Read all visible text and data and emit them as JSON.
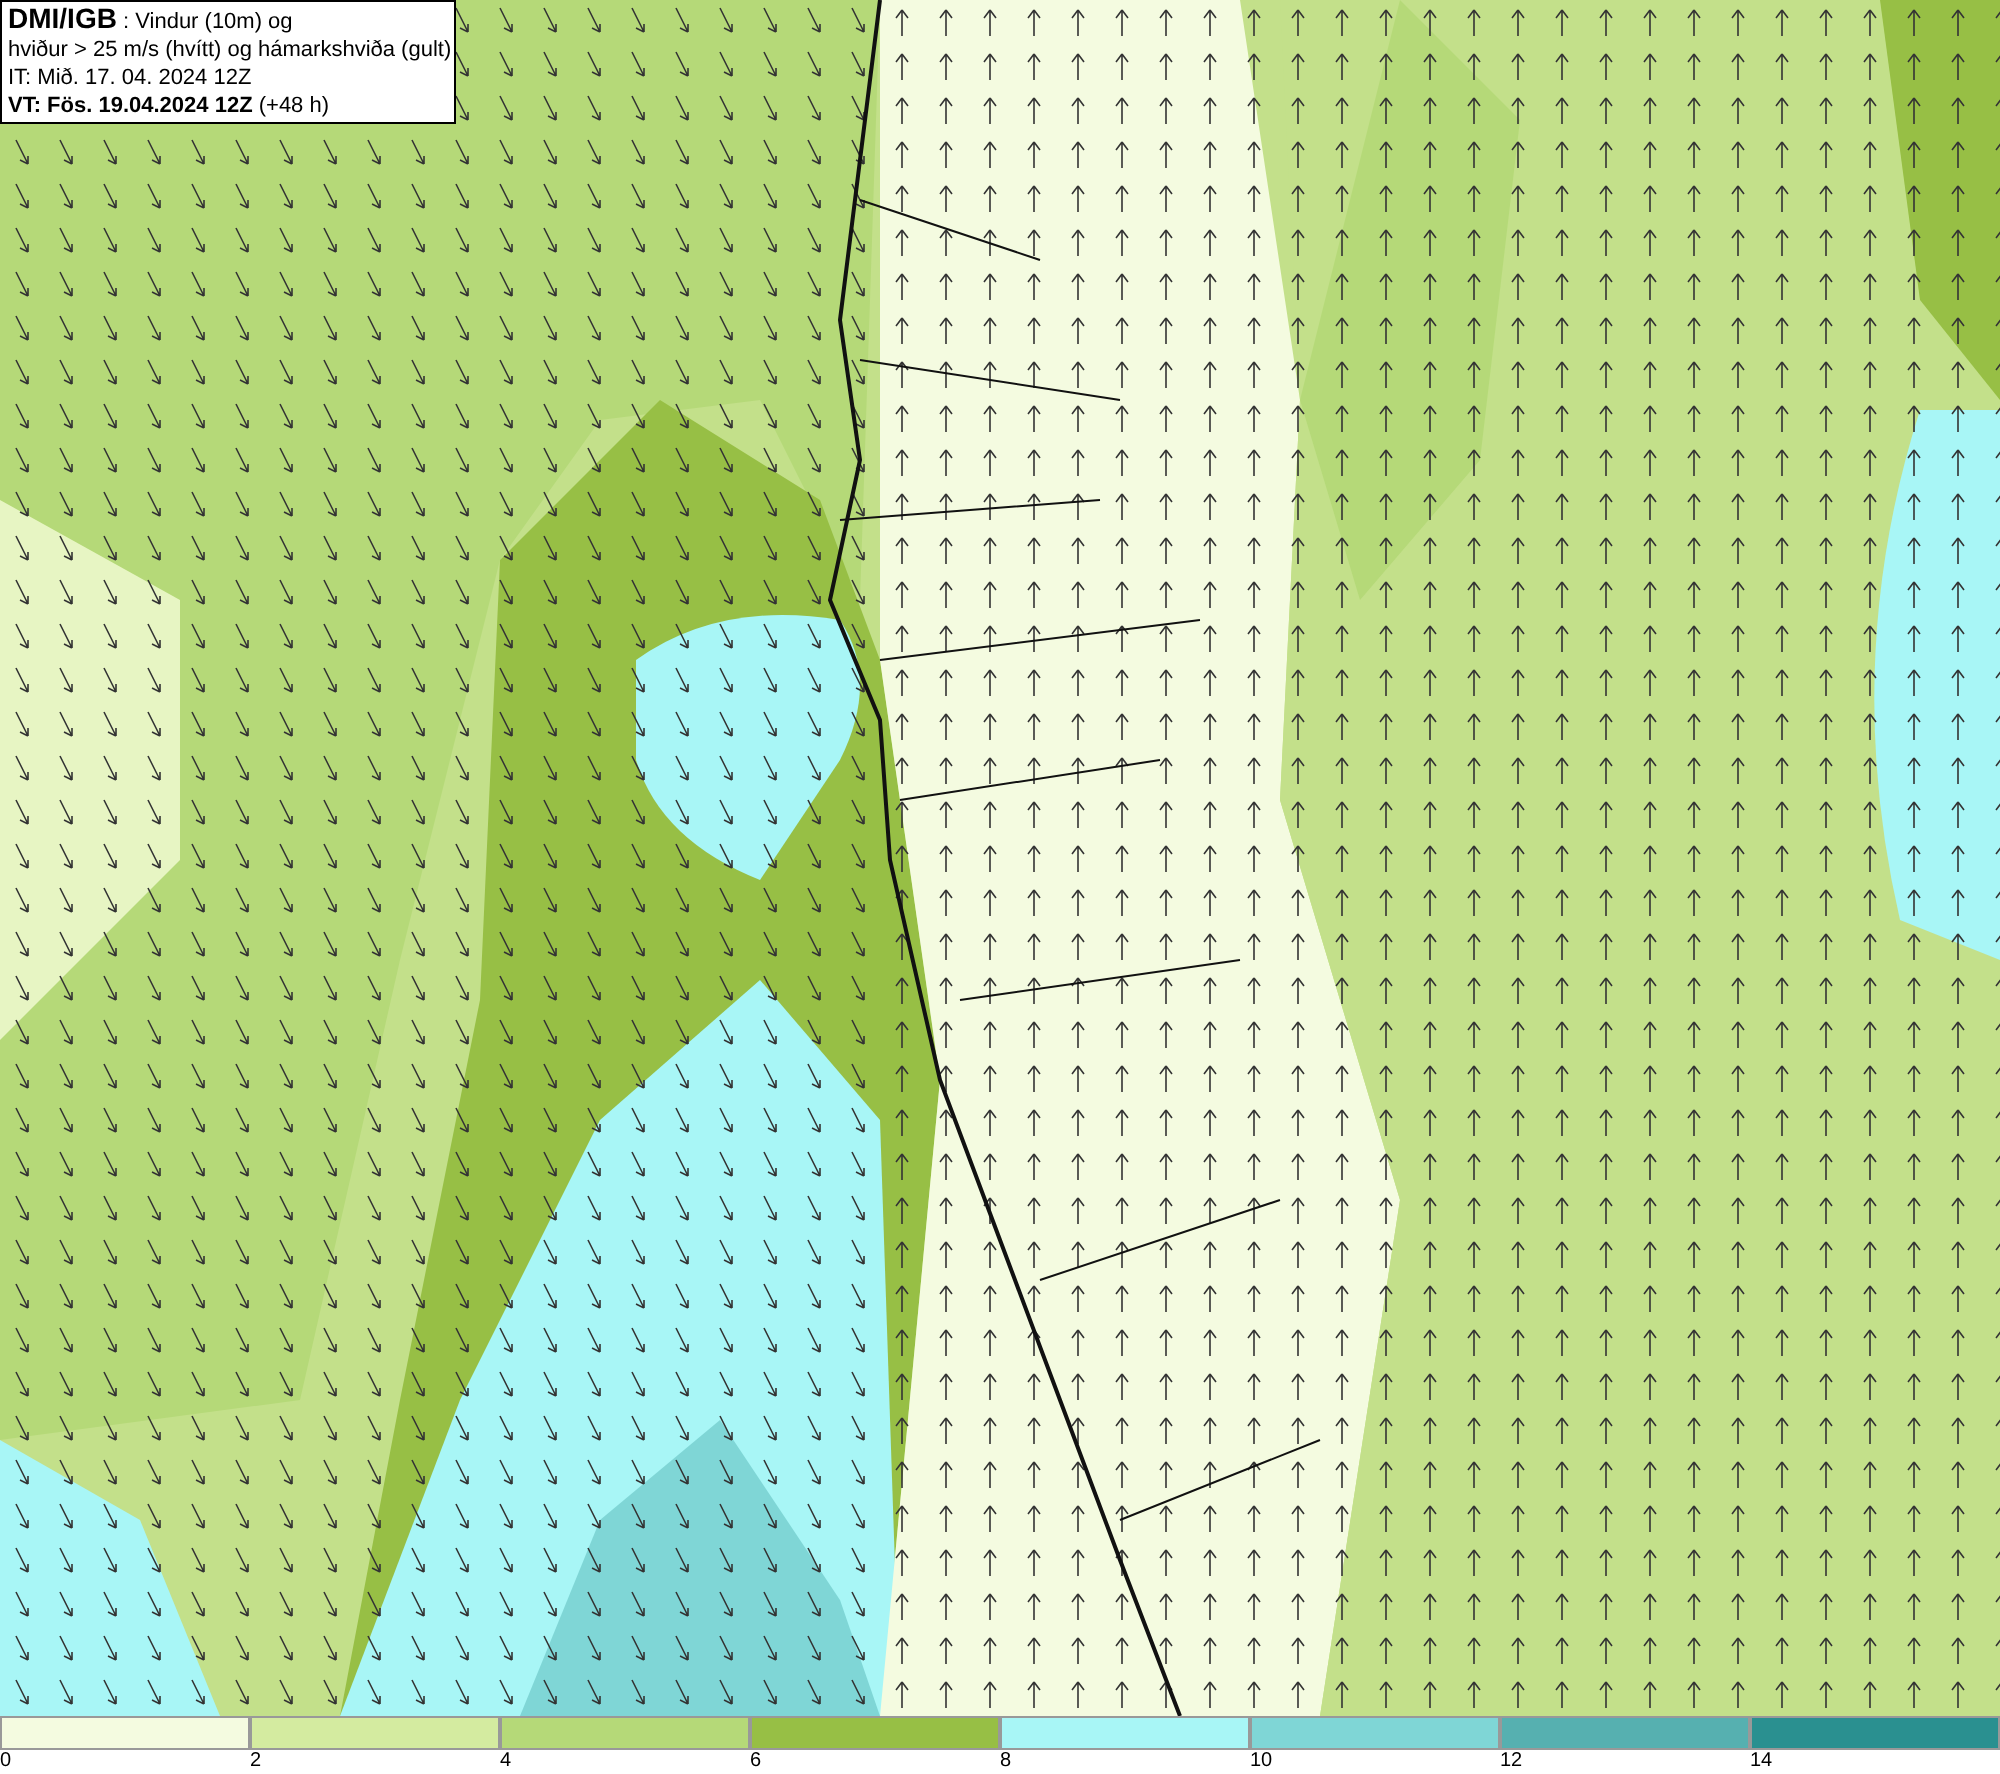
{
  "header": {
    "lines": [
      "**DMI/IGB** : Vindur (10m) og",
      "hviður > 25 m/s (hvítt) og hámarkshviða (gult)",
      "IT: Mið. 17. 04. 2024 12Z",
      "**VT: Fös. 19.04.2024 12Z** (+48 h)"
    ]
  },
  "legend": {
    "bins": [
      {
        "color": "#f4fbe0",
        "label": "0"
      },
      {
        "color": "#d4eba0",
        "label": "2"
      },
      {
        "color": "#b5d978",
        "label": "4"
      },
      {
        "color": "#97bf45",
        "label": "6"
      },
      {
        "color": "#a8f6f6",
        "label": "8"
      },
      {
        "color": "#7fd6d6",
        "label": "10"
      },
      {
        "color": "#56b0b0",
        "label": "12"
      },
      {
        "color": "#2a9090",
        "label": "14"
      }
    ]
  }
}
